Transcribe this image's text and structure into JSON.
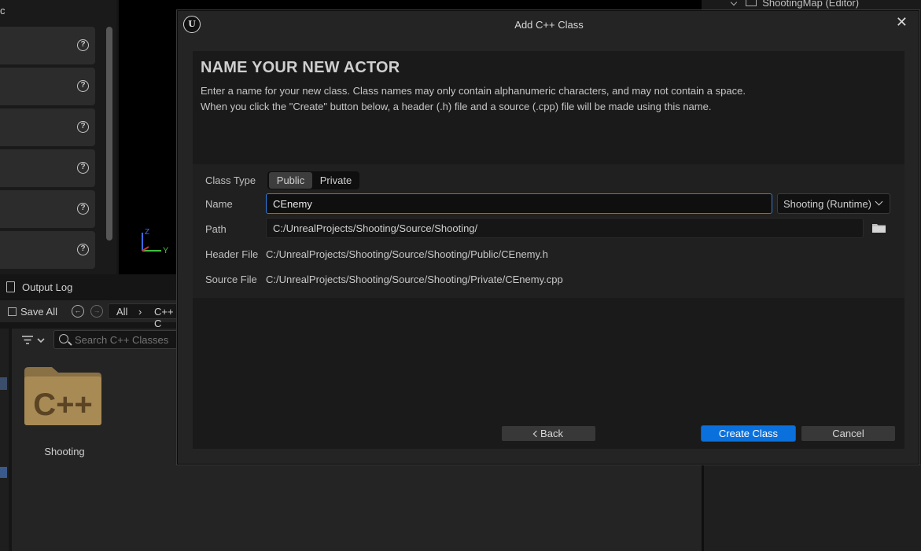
{
  "background": {
    "left_panel_title": "c",
    "outliner_item": "ShootingMap (Editor)",
    "viewport_axis_y": "Y",
    "viewport_axis_z": "Z",
    "output_log_tab": "Output Log",
    "content_browser": {
      "save_all": "Save All",
      "breadcrumb_all": "All",
      "breadcrumb_cpp": "C++ C",
      "search_placeholder": "Search C++ Classes",
      "folder_glyph": "C++",
      "folder_label": "Shooting"
    }
  },
  "dialog": {
    "title": "Add C++ Class",
    "logo": "U",
    "headline": "NAME YOUR NEW ACTOR",
    "description_line1": "Enter a name for your new class. Class names may only contain alphanumeric characters, and may not contain a space.",
    "description_line2": "When you click the \"Create\" button below, a header (.h) file and a source (.cpp) file will be made using this name.",
    "form": {
      "class_type_label": "Class Type",
      "class_type_options": [
        "Public",
        "Private"
      ],
      "class_type_selected": "Public",
      "name_label": "Name",
      "name_value": "CEnemy",
      "module_value": "Shooting (Runtime)",
      "path_label": "Path",
      "path_value": "C:/UnrealProjects/Shooting/Source/Shooting/",
      "header_label": "Header File",
      "header_value": "C:/UnrealProjects/Shooting/Source/Shooting/Public/CEnemy.h",
      "source_label": "Source File",
      "source_value": "C:/UnrealProjects/Shooting/Source/Shooting/Private/CEnemy.cpp"
    },
    "buttons": {
      "back": "Back",
      "create": "Create Class",
      "cancel": "Cancel"
    }
  },
  "colors": {
    "accent": "#0a70dc",
    "focus_border": "#2f7ddb",
    "folder": "#a88a55"
  }
}
